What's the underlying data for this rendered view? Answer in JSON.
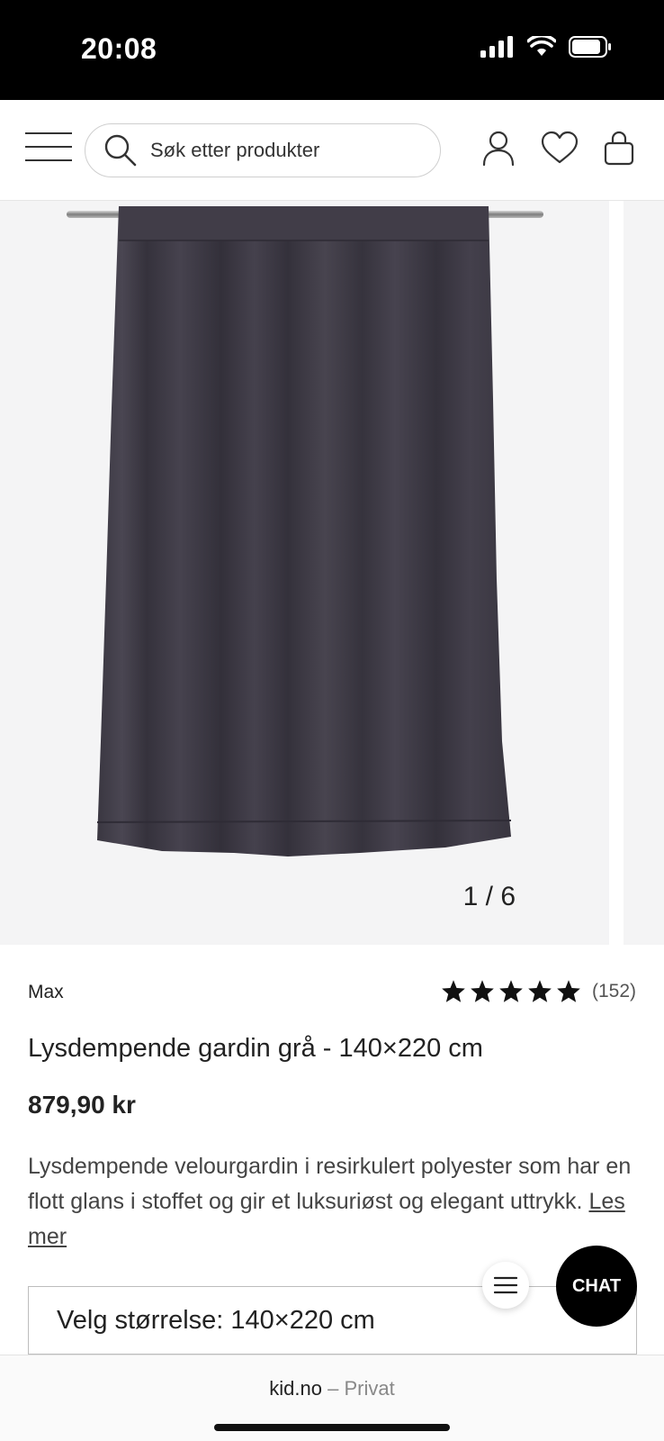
{
  "status_bar": {
    "time": "20:08"
  },
  "header": {
    "search_placeholder": "Søk etter produkter",
    "icons": [
      "menu-icon",
      "search-icon",
      "account-icon",
      "heart-icon",
      "bag-icon"
    ]
  },
  "gallery": {
    "counter": "1 / 6",
    "image": "dark grey velour curtain on rod"
  },
  "product": {
    "brand": "Max",
    "rating_count": "(152)",
    "rating_stars": 5,
    "title": "Lysdempende gardin grå - 140×220 cm",
    "price": "879,90 kr",
    "description": "Lysdempende velourgardin i resirkulert polyester som har en flott glans i stoffet og gir et luksuriøst og elegant uttrykk.",
    "read_more": "Les mer"
  },
  "size_select": {
    "label": "Velg størrelse: 140×220 cm"
  },
  "chat": {
    "label": "CHAT"
  },
  "browser": {
    "domain": "kid.no",
    "mode": " – Privat"
  },
  "colors": {
    "curtain": "#3d3a44",
    "gallery_bg": "#f4f4f5",
    "star": "#111111"
  }
}
